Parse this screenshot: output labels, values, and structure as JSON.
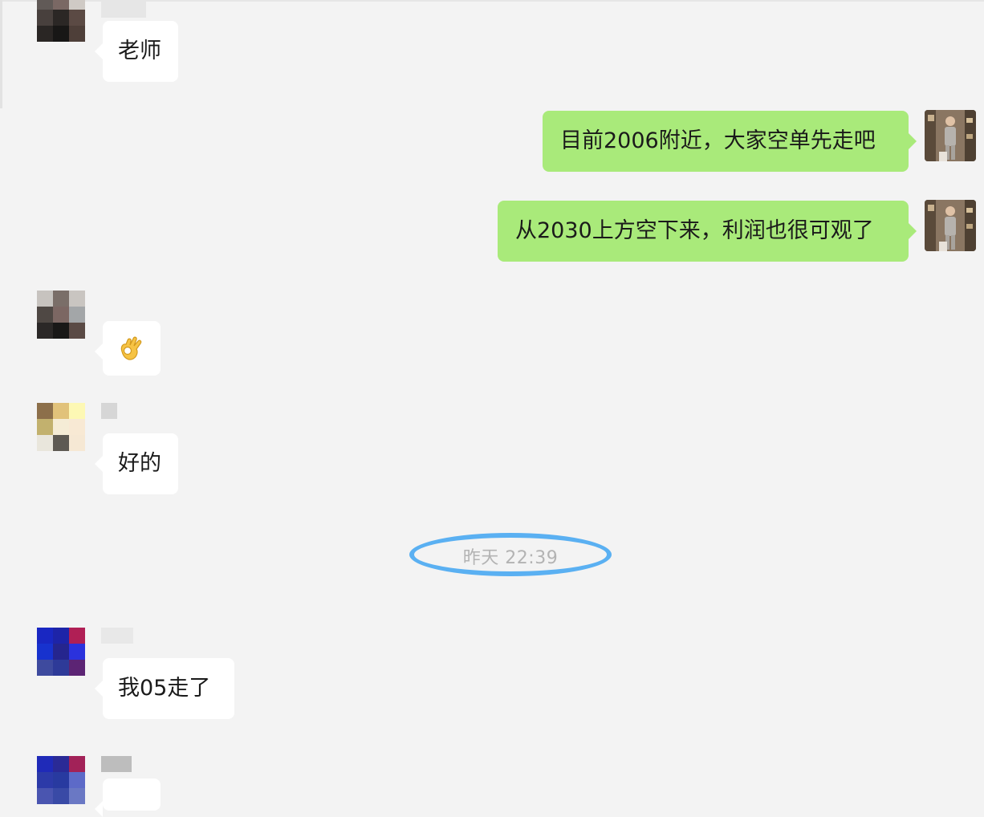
{
  "messages": {
    "m1": {
      "text": "老师"
    },
    "m2": {
      "text": "目前2006附近，大家空单先走吧"
    },
    "m3": {
      "text": "从2030上方空下来，利润也很可观了"
    },
    "m4": {
      "emoji": "ok-hand-emoji"
    },
    "m5": {
      "text": "好的"
    },
    "m6": {
      "text": "我05走了"
    }
  },
  "timestamp": {
    "text": "昨天 22:39"
  },
  "colors": {
    "background": "#f3f3f3",
    "incoming_bubble": "#ffffff",
    "outgoing_bubble": "#a9ea7a",
    "highlight_circle": "#5ab0f2",
    "timestamp_text": "#b3b3b3"
  }
}
